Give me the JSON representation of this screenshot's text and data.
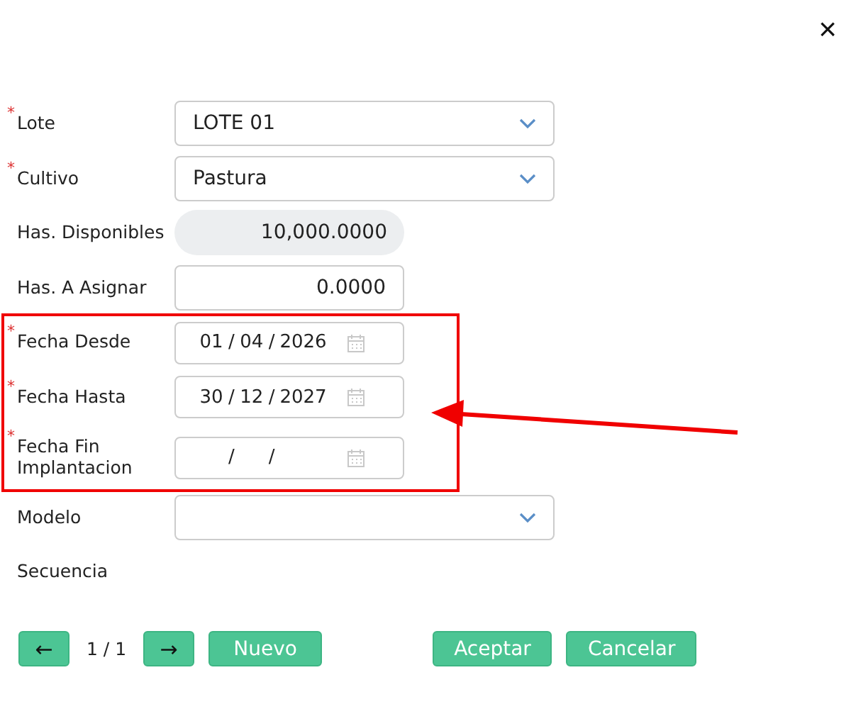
{
  "close_label": "×",
  "fields": [
    {
      "kind": "select",
      "label": "Lote",
      "required": true,
      "value": "LOTE 01"
    },
    {
      "kind": "select",
      "label": "Cultivo",
      "required": true,
      "value": "Pastura"
    },
    {
      "kind": "readonly",
      "label": "Has. Disponibles",
      "required": false,
      "value": "10,000.0000"
    },
    {
      "kind": "number",
      "label": "Has. A Asignar",
      "required": false,
      "value": "0.0000"
    },
    {
      "kind": "date",
      "label": "Fecha Desde",
      "required": true,
      "day": "01",
      "month": "04",
      "year": "2026",
      "separator": "/"
    },
    {
      "kind": "date",
      "label": "Fecha Hasta",
      "required": true,
      "day": "30",
      "month": "12",
      "year": "2027",
      "separator": "/"
    },
    {
      "kind": "date",
      "label": "Fecha Fin Implantacion",
      "required": true,
      "separator": "/"
    },
    {
      "kind": "select",
      "label": "Modelo",
      "required": false
    },
    {
      "kind": "none",
      "label": "Secuencia",
      "required": false
    }
  ],
  "required_mark": "*",
  "pager": {
    "prev": "←",
    "page": "1 / 1",
    "next": "→"
  },
  "buttons": [
    "Nuevo",
    "Aceptar",
    "Cancelar"
  ]
}
